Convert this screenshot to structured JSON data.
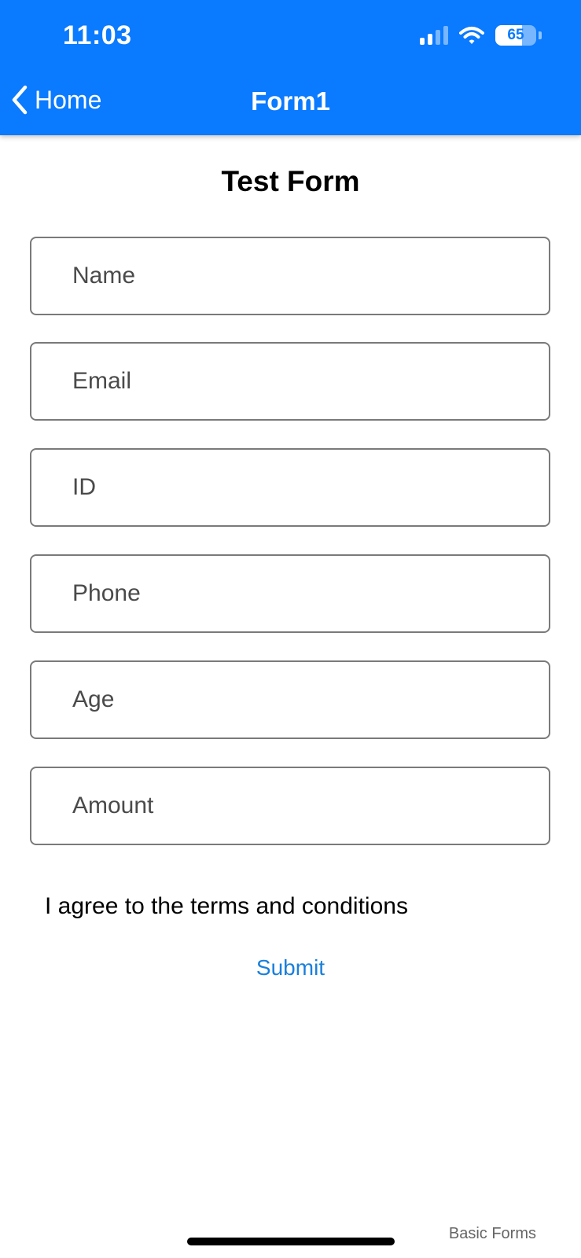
{
  "status_bar": {
    "time": "11:03",
    "battery_level": "65",
    "battery_fraction": 0.65
  },
  "nav_bar": {
    "back_label": "Home",
    "title": "Form1",
    "background_color": "#0A7AFF"
  },
  "form": {
    "title": "Test Form",
    "fields": [
      {
        "placeholder": "Name",
        "value": ""
      },
      {
        "placeholder": "Email",
        "value": ""
      },
      {
        "placeholder": "ID",
        "value": ""
      },
      {
        "placeholder": "Phone",
        "value": ""
      },
      {
        "placeholder": "Age",
        "value": ""
      },
      {
        "placeholder": "Amount",
        "value": ""
      }
    ],
    "terms_label": "I agree to the terms and conditions",
    "submit_label": "Submit"
  },
  "footer": {
    "label": "Basic Forms"
  },
  "colors": {
    "accent": "#0A7AFF",
    "link": "#1A7FDB"
  }
}
